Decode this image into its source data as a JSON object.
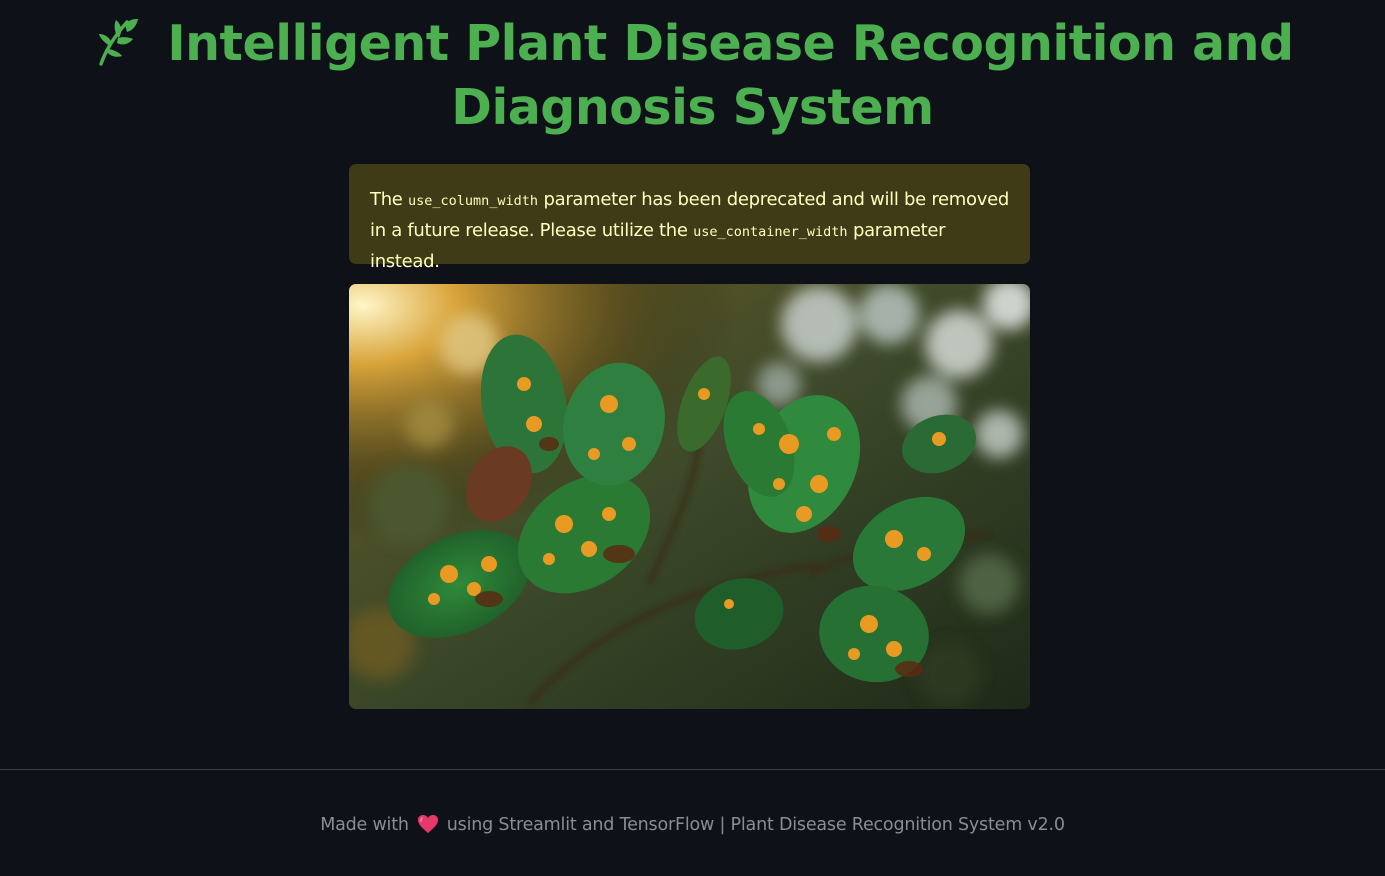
{
  "header": {
    "title": "Intelligent Plant Disease Recognition and Diagnosis System",
    "icon": "herb-leaf-icon",
    "accent_color": "#4caf50"
  },
  "warning": {
    "part1": "The ",
    "code1": "use_column_width",
    "part2": " parameter has been deprecated and will be removed in a future release. Please utilize the ",
    "code2": "use_container_width",
    "part3": " parameter instead.",
    "background_color": "#3e3b16",
    "text_color": "#ffffc2"
  },
  "main": {
    "image": {
      "subject": "rust-spotted-leaves-photo"
    }
  },
  "footer": {
    "text_before_icon": "Made with",
    "icon": "heart-icon",
    "text_after_icon": "using Streamlit and TensorFlow | Plant Disease Recognition System v2.0"
  },
  "theme": {
    "background": "#0e1117",
    "divider": "#3a3d45"
  }
}
